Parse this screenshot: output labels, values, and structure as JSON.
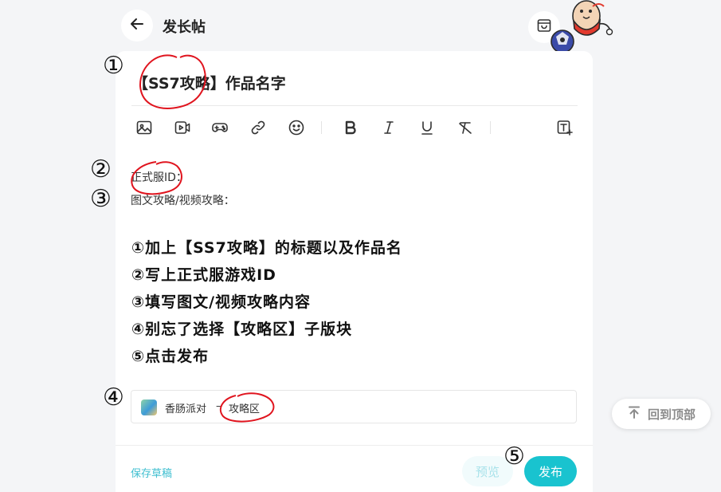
{
  "header": {
    "title": "发长帖"
  },
  "editor": {
    "title_text": "【SS7攻略】作品名字",
    "toolbar_icons": [
      "image-icon",
      "video-icon",
      "gamepad-icon",
      "link-icon",
      "emoji-icon",
      "bold-icon",
      "italic-icon",
      "underline-icon",
      "clear-format-icon",
      "text-size-icon"
    ],
    "body_lines": [
      "正式服ID：",
      "图文攻略/视频攻略："
    ],
    "instructions": [
      "①加上【SS7攻略】的标题以及作品名",
      "②写上正式服游戏ID",
      "③填写图文/视频攻略内容",
      "④别忘了选择【攻略区】子版块",
      "⑤点击发布"
    ],
    "forum": {
      "game": "香肠派对",
      "separator": "–",
      "section": "攻略区"
    }
  },
  "footer": {
    "save_draft": "保存草稿",
    "preview": "预览",
    "publish": "发布"
  },
  "back_to_top": "回到顶部",
  "annotations": [
    "①",
    "②",
    "③",
    "④",
    "⑤"
  ],
  "colors": {
    "accent": "#19c3cf",
    "annotation_ink": "#e0141e",
    "page_bg": "#f4f5f7"
  }
}
